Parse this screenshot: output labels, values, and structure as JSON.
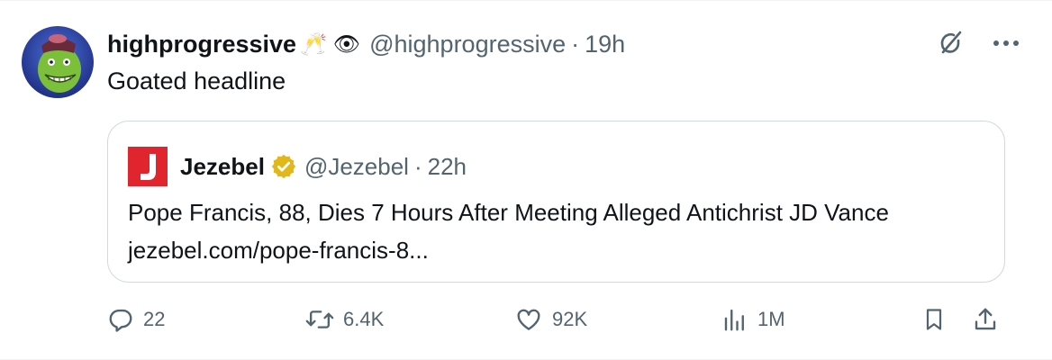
{
  "post": {
    "display_name": "highprogressive",
    "name_emojis": "🥂 👁",
    "handle": "@highprogressive",
    "separator": "·",
    "time": "19h",
    "text": "Goated headline"
  },
  "quoted": {
    "display_name": "Jezebel",
    "handle": "@Jezebel",
    "separator": "·",
    "time": "22h",
    "text": "Pope Francis, 88, Dies 7 Hours After Meeting Alleged Antichrist JD Vance jezebel.com/pope-francis-8...",
    "logo_color": "#e0252f",
    "verified_color": "#e2b719"
  },
  "metrics": {
    "replies": "22",
    "reposts": "6.4K",
    "likes": "92K",
    "views": "1M"
  },
  "icons": {
    "grok": "grok-icon",
    "more": "more-icon",
    "reply": "reply-icon",
    "repost": "repost-icon",
    "like": "like-icon",
    "views": "views-icon",
    "bookmark": "bookmark-icon",
    "share": "share-icon"
  },
  "colors": {
    "text_primary": "#0f1419",
    "text_secondary": "#536471",
    "border": "#cfd9de"
  }
}
